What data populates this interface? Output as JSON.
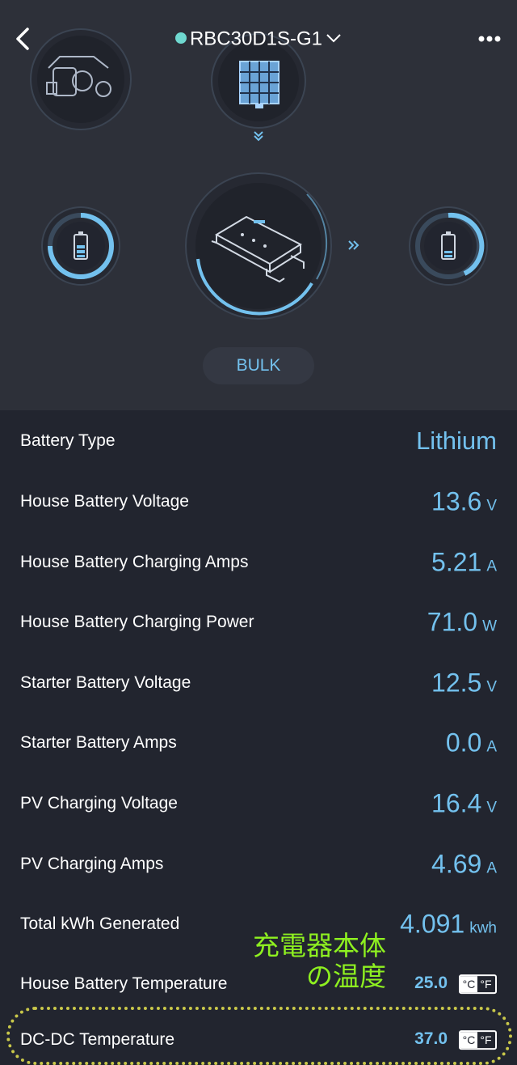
{
  "header": {
    "device_title": "RBC30D1S-G1"
  },
  "status": {
    "charge_stage": "BULK"
  },
  "colors": {
    "accent": "#73c1ee",
    "status_dot": "#6fd8d0",
    "annotation": "#8ef020"
  },
  "readings": [
    {
      "label": "Battery Type",
      "value": "Lithium",
      "unit": ""
    },
    {
      "label": "House Battery Voltage",
      "value": "13.6",
      "unit": "V"
    },
    {
      "label": "House Battery Charging Amps",
      "value": "5.21",
      "unit": "A"
    },
    {
      "label": "House Battery Charging Power",
      "value": "71.0",
      "unit": "W"
    },
    {
      "label": "Starter Battery Voltage",
      "value": "12.5",
      "unit": "V"
    },
    {
      "label": "Starter Battery Amps",
      "value": "0.0",
      "unit": "A"
    },
    {
      "label": "PV Charging Voltage",
      "value": "16.4",
      "unit": "V"
    },
    {
      "label": "PV Charging Amps",
      "value": "4.69",
      "unit": "A"
    },
    {
      "label": "Total kWh Generated",
      "value": "4.091",
      "unit": "kwh"
    },
    {
      "label": "House Battery Temperature",
      "value": "25.0",
      "unit_c": "°C",
      "unit_f": "°F"
    },
    {
      "label": "DC-DC Temperature",
      "value": "37.0",
      "unit_c": "°C",
      "unit_f": "°F"
    }
  ],
  "annotation": {
    "line1": "充電器本体",
    "line2": "の温度"
  },
  "icons": [
    "back-icon",
    "chevron-down-icon",
    "more-icon",
    "engine-icon",
    "solar-panel-icon",
    "double-chevron-down-icon",
    "battery-icon",
    "charger-device-icon",
    "double-chevron-right-icon"
  ]
}
